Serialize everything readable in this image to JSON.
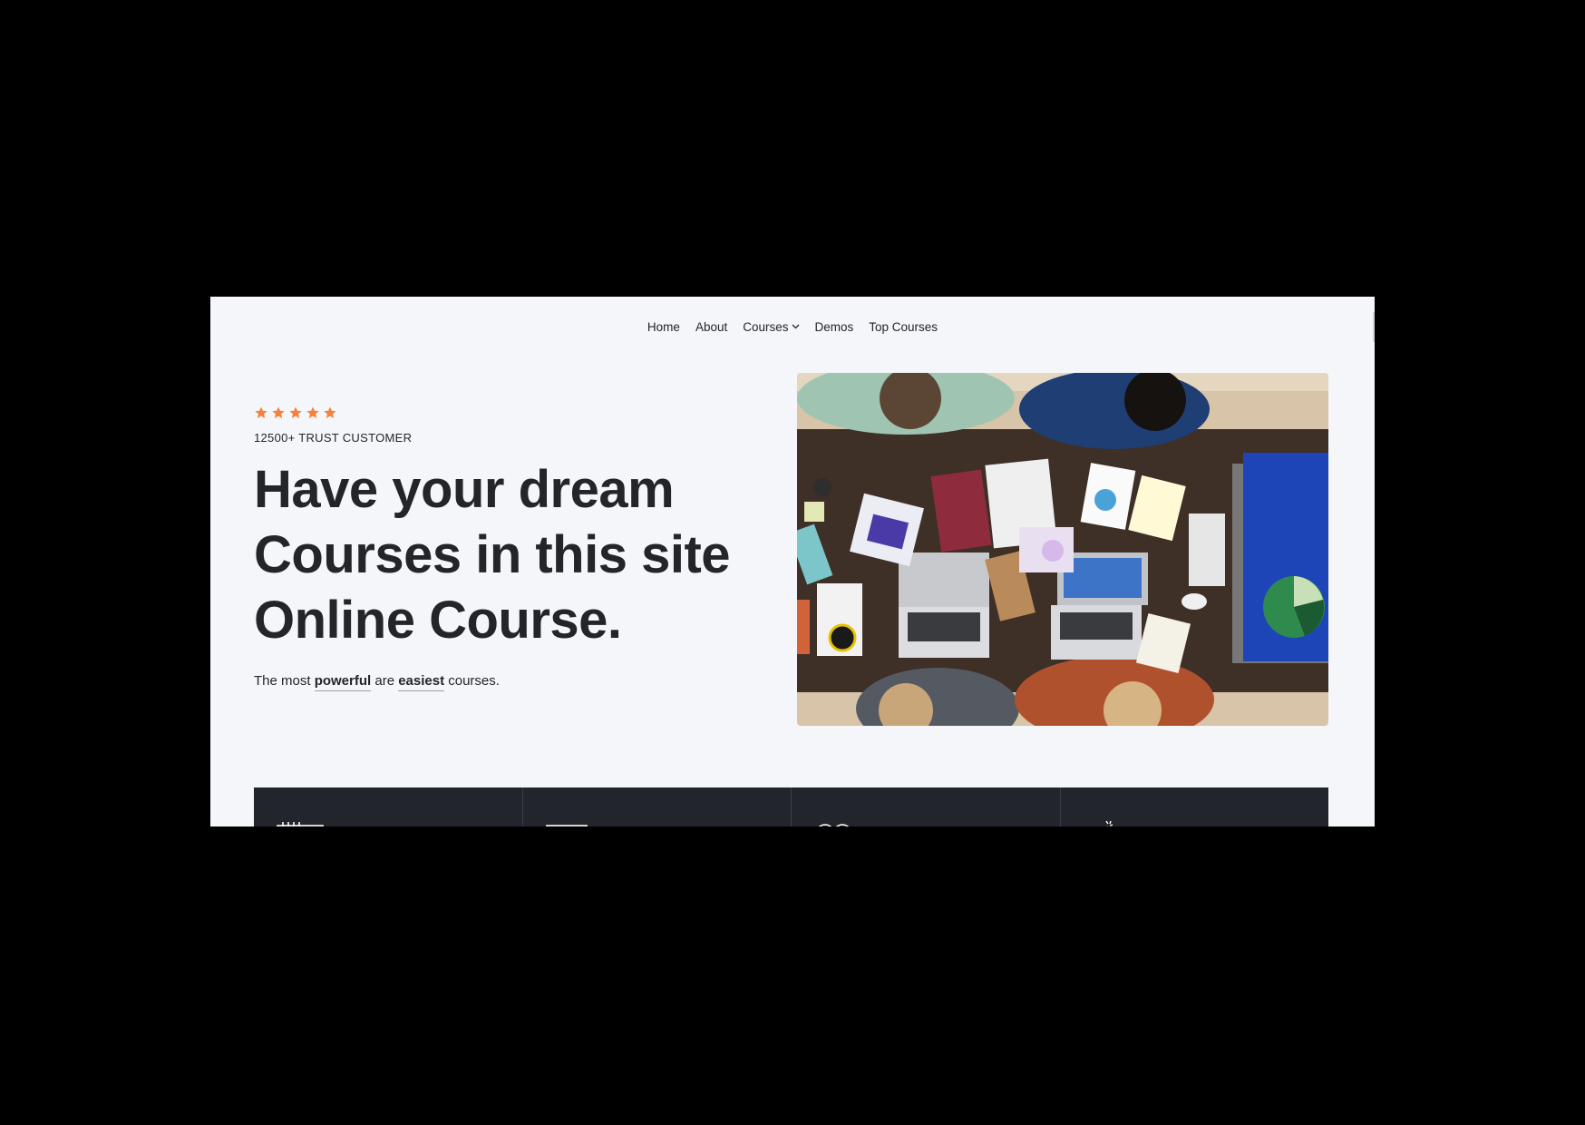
{
  "nav": {
    "items": [
      "Home",
      "About",
      "Courses",
      "Demos",
      "Top Courses"
    ]
  },
  "hero": {
    "rating_stars": 5,
    "star_color": "#f5813a",
    "trust_text": "12500+ TRUST CUSTOMER",
    "headline_lines": [
      "Have your dream",
      "Courses in this site",
      "Online Course."
    ],
    "subtitle": {
      "prefix": "The most ",
      "bold1": "powerful",
      "middle": " are ",
      "bold2": "easiest",
      "suffix": " courses."
    }
  },
  "features": {
    "icons": [
      "ruler-pen-icon",
      "laptop-icon",
      "badge-check-icon",
      "handshake-icon"
    ]
  },
  "colors": {
    "page_bg": "#f4f6fa",
    "text": "#23252b",
    "feature_bar": "#22252b"
  }
}
